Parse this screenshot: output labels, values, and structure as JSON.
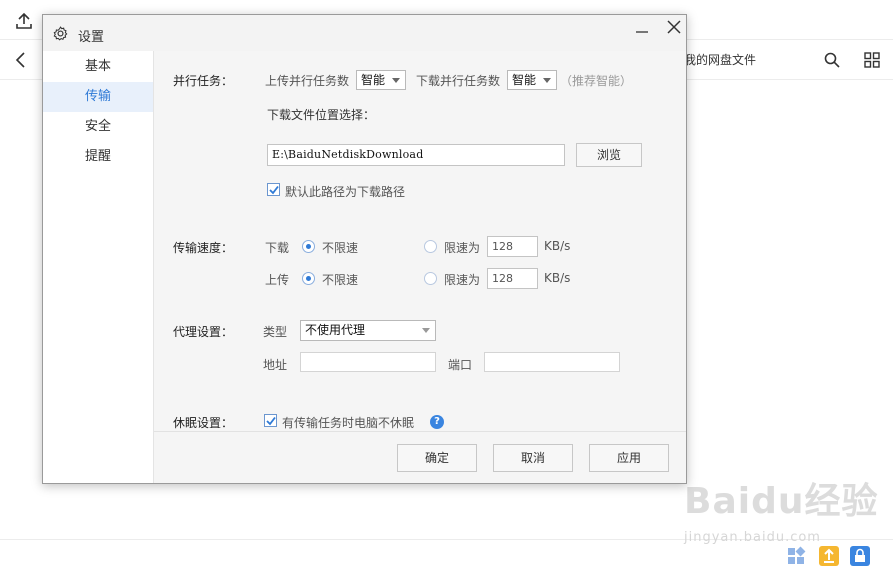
{
  "app": {
    "breadcrumb": "我的网盘文件",
    "icons": {
      "upload": "upload-icon",
      "back": "back-arrow-icon",
      "search": "search-icon",
      "grid": "grid-view-icon",
      "bottom_tools": [
        "apps-icon",
        "upload-status-icon",
        "lock-icon"
      ]
    },
    "colors": {
      "accent": "#2f7ad6",
      "yellow_tool": "#f5b731",
      "blue_tool": "#3a85e0"
    }
  },
  "dialog": {
    "title": "设置",
    "icons": {
      "title": "gear-icon",
      "minimize": "minimize-icon",
      "close": "close-icon"
    },
    "sidebar": {
      "items": [
        {
          "label": "基本",
          "active": false
        },
        {
          "label": "传输",
          "active": true
        },
        {
          "label": "安全",
          "active": false
        },
        {
          "label": "提醒",
          "active": false
        }
      ]
    },
    "parallel": {
      "section_label": "并行任务：",
      "upload_label": "上传并行任务数",
      "upload_value": "智能",
      "download_label": "下载并行任务数",
      "download_value": "智能",
      "hint": "（推荐智能）"
    },
    "download_location": {
      "label": "下载文件位置选择：",
      "path": "E:\\BaiduNetdiskDownload",
      "browse_label": "浏览",
      "default_checkbox_label": "默认此路径为下载路径",
      "default_checked": true
    },
    "speed": {
      "section_label": "传输速度：",
      "download_label": "下载",
      "upload_label": "上传",
      "unlimited_label": "不限速",
      "limit_label": "限速为",
      "download_limit_value": "128",
      "upload_limit_value": "128",
      "unit": "KB/s",
      "download_mode": "unlimited",
      "upload_mode": "unlimited"
    },
    "proxy": {
      "section_label": "代理设置：",
      "type_label": "类型",
      "type_value": "不使用代理",
      "address_label": "地址",
      "address_value": "",
      "port_label": "端口",
      "port_value": ""
    },
    "sleep": {
      "section_label": "休眠设置：",
      "checkbox_label": "有传输任务时电脑不休眠",
      "checked": true
    },
    "buttons": {
      "ok": "确定",
      "cancel": "取消",
      "apply": "应用"
    }
  },
  "watermark": {
    "main": "Baidu经验",
    "sub": "jingyan.baidu.com"
  }
}
